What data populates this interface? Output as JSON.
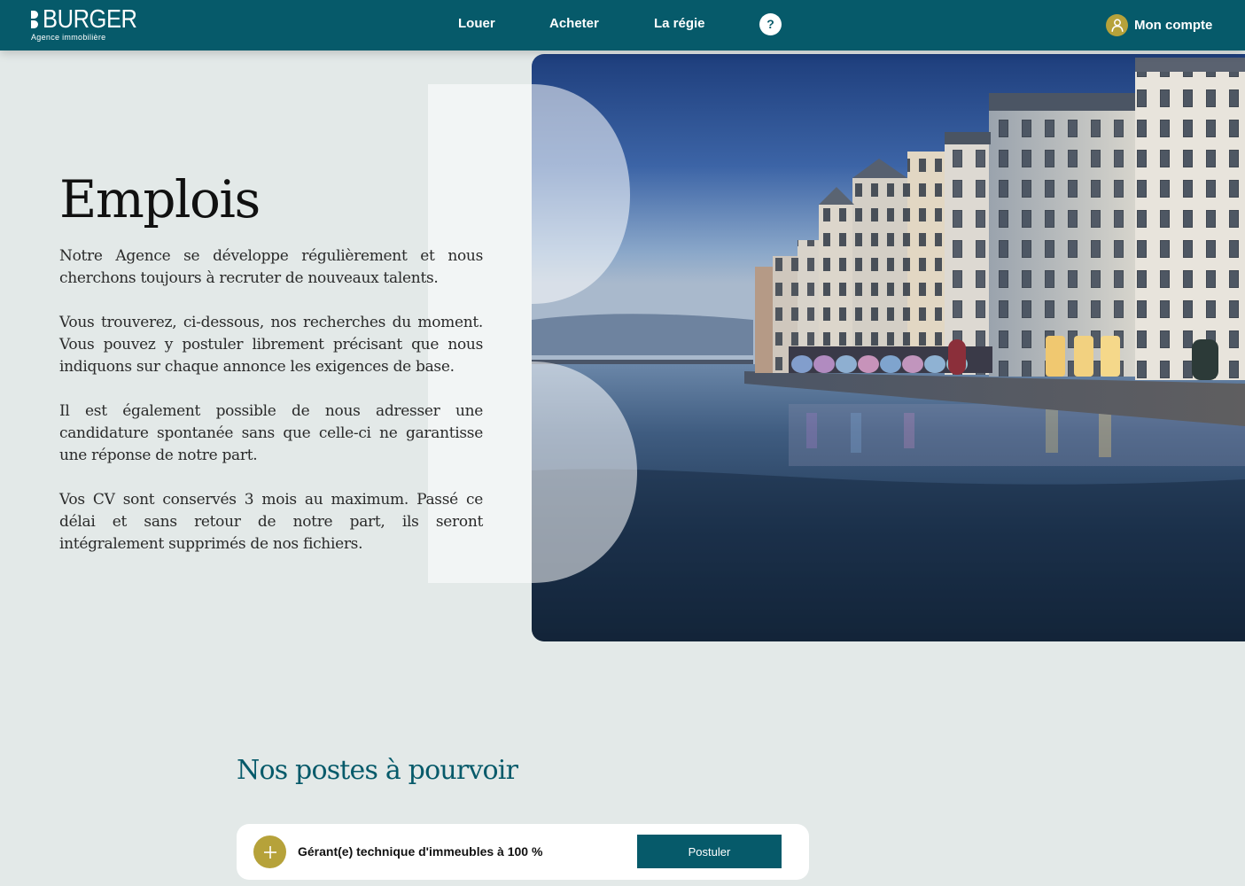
{
  "brand": {
    "name": "BURGER",
    "tagline": "Agence immobilière"
  },
  "nav": {
    "items": [
      {
        "label": "Louer"
      },
      {
        "label": "Acheter"
      },
      {
        "label": "La régie"
      }
    ],
    "help_label": "?",
    "account_label": "Mon compte"
  },
  "hero": {
    "title": "Emplois",
    "paragraphs": [
      "Notre Agence se développe régulièrement et nous cherchons toujours à recruter de nouveaux talents.",
      "Vous trouverez, ci-dessous, nos recherches du moment. Vous pouvez y postuler librement précisant que nous indiquons sur chaque annonce les exigences de base.",
      "Il est également possible de nous adresser une candidature spontanée sans que celle-ci ne garantisse une réponse de notre part.",
      "Vos CV sont conservés 3 mois au maximum. Passé ce délai et sans retour de notre part, ils seront intégralement supprimés de nos fichiers."
    ]
  },
  "positions": {
    "title": "Nos postes à pourvoir",
    "jobs": [
      {
        "title": "Gérant(e) technique d'immeubles à 100 %",
        "apply_label": "Postuler"
      }
    ]
  },
  "icons": {
    "account": "user-icon",
    "expand": "plus-icon",
    "help": "question-icon"
  },
  "colors": {
    "primary": "#065a6a",
    "accent": "#b6a23a",
    "background": "#e3e9e8"
  }
}
